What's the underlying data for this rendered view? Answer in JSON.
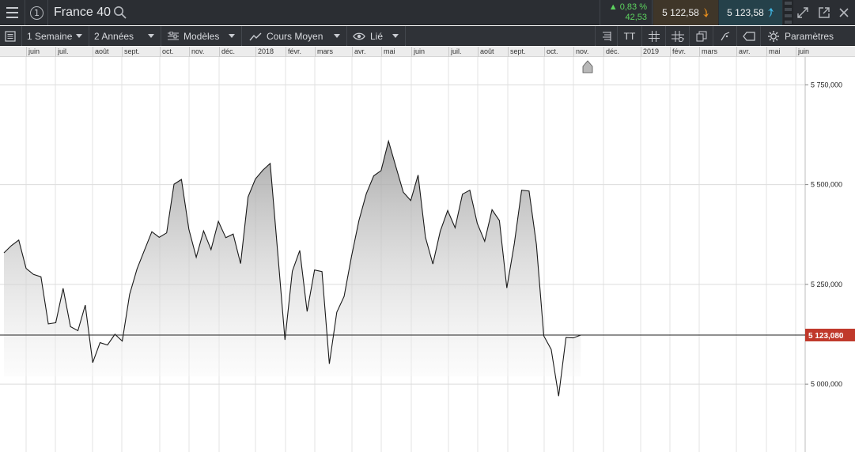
{
  "header": {
    "instrument": "France 40",
    "info_label": "1",
    "change_pct": "▲ 0,83 %",
    "change_abs": "42,53",
    "sell_price": "5 122,58",
    "buy_price": "5 123,58"
  },
  "toolbar": {
    "period": "1 Semaine",
    "range": "2 Années",
    "templates": "Modèles",
    "indicator": "Cours Moyen",
    "linked": "Lié",
    "settings": "Paramètres",
    "text_tool": "TT"
  },
  "colors": {
    "topbar": "#2b2e33",
    "toolbar": "#2f3237",
    "positive": "#5dd35f",
    "sell_bg": "#3f3629",
    "buy_bg": "#25414a",
    "last_price_bg": "#c0392b"
  },
  "time_axis": [
    "juin",
    "juil.",
    "août",
    "sept.",
    "oct.",
    "nov.",
    "déc.",
    "2018",
    "févr.",
    "mars",
    "avr.",
    "mai",
    "juin",
    "juil.",
    "août",
    "sept.",
    "oct.",
    "nov.",
    "déc.",
    "2019",
    "févr.",
    "mars",
    "avr.",
    "mai",
    "juin"
  ],
  "chart_data": {
    "type": "area",
    "x_period": "1 Semaine",
    "ylim": [
      4830000,
      5820000
    ],
    "yticks": [
      5000000,
      5250000,
      5500000,
      5750000
    ],
    "ytick_labels": [
      "5 000,000",
      "5 250,000",
      "5 500,000",
      "5 750,000"
    ],
    "last_value": 5123080,
    "last_value_label": "5 123,080",
    "grid": true,
    "values": [
      5329000,
      5347000,
      5361000,
      5290000,
      5275000,
      5269000,
      5151000,
      5154000,
      5240000,
      5144000,
      5134000,
      5198000,
      5054000,
      5104000,
      5098000,
      5125000,
      5108000,
      5225000,
      5289000,
      5336000,
      5382000,
      5368000,
      5379000,
      5501000,
      5513000,
      5388000,
      5318000,
      5384000,
      5337000,
      5408000,
      5367000,
      5376000,
      5302000,
      5469000,
      5514000,
      5536000,
      5553000,
      5335000,
      5111000,
      5283000,
      5335000,
      5182000,
      5286000,
      5282000,
      5051000,
      5180000,
      5220000,
      5320000,
      5410000,
      5477000,
      5522000,
      5535000,
      5609000,
      5545000,
      5481000,
      5460000,
      5524000,
      5368000,
      5301000,
      5383000,
      5435000,
      5392000,
      5476000,
      5486000,
      5403000,
      5358000,
      5437000,
      5410000,
      5241000,
      5350000,
      5486000,
      5484000,
      5350000,
      5121000,
      5087000,
      4970000,
      5117000,
      5116000,
      5123000
    ]
  }
}
